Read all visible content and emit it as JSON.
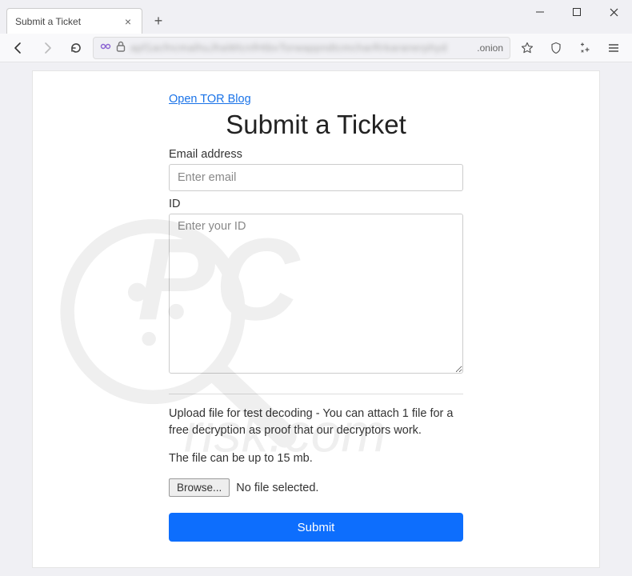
{
  "window": {
    "tab_title": "Submit a Ticket",
    "url_suffix": ".onion"
  },
  "toolbar": {
    "back": "Back",
    "forward": "Forward",
    "reload": "Reload"
  },
  "page": {
    "blog_link": "Open TOR Blog",
    "title": "Submit a Ticket",
    "email_label": "Email address",
    "email_placeholder": "Enter email",
    "id_label": "ID",
    "id_placeholder": "Enter your ID",
    "upload_desc": "Upload file for test decoding - You can attach 1 file for a free decryption as proof that our decryptors work.",
    "size_note": "The file can be up to 15 mb.",
    "browse_label": "Browse...",
    "file_status": "No file selected.",
    "submit_label": "Submit"
  }
}
